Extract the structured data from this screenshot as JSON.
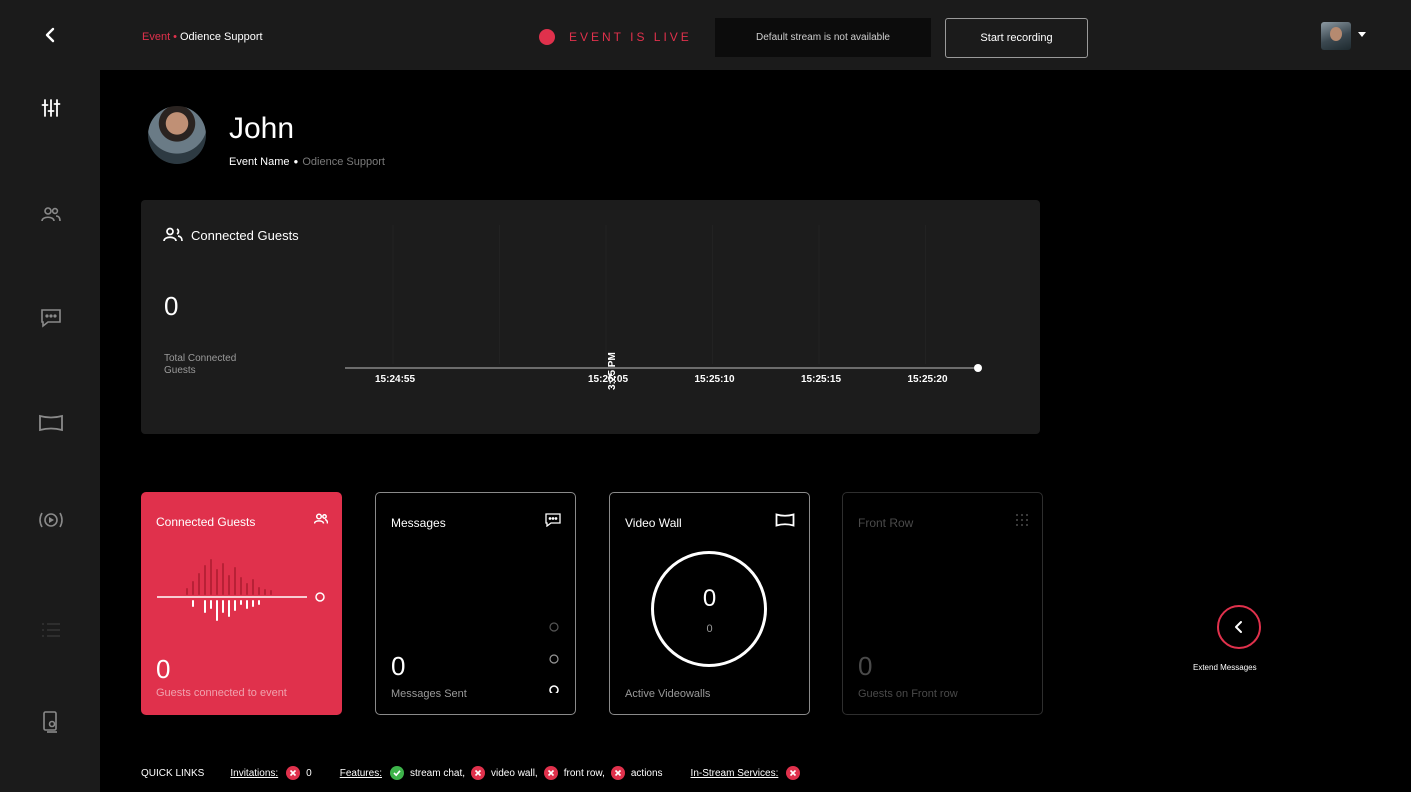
{
  "header": {
    "breadcrumb_event": "Event",
    "breadcrumb_sep": "•",
    "breadcrumb_current": "Odience Support",
    "live_status": "EVENT IS LIVE",
    "stream_status": "Default stream is not available",
    "record_button": "Start recording"
  },
  "sidebar": {
    "items": [
      "controls-icon",
      "guests-icon",
      "messages-icon",
      "videowall-icon",
      "stream-icon",
      "list-icon",
      "device-icon"
    ]
  },
  "profile": {
    "name": "John",
    "event_label": "Event Name",
    "event_value": "Odience Support"
  },
  "guests_panel": {
    "title": "Connected Guests",
    "total": "0",
    "total_label": "Total Connected Guests"
  },
  "chart_data": {
    "type": "line",
    "x": [
      "15:24:55",
      "3:25 PM",
      "15:25:05",
      "15:25:10",
      "15:25:15",
      "15:25:20"
    ],
    "series": [
      {
        "values": [
          0,
          0,
          0,
          0,
          0,
          0
        ]
      }
    ],
    "xlabel": "",
    "ylabel": "",
    "grid": true
  },
  "cards": {
    "guests": {
      "title": "Connected Guests",
      "value": "0",
      "caption": "Guests connected to event"
    },
    "messages": {
      "title": "Messages",
      "value": "0",
      "caption": "Messages Sent"
    },
    "videowall": {
      "title": "Video Wall",
      "value": "0",
      "sub_value": "0",
      "caption": "Active Videowalls"
    },
    "frontrow": {
      "title": "Front Row",
      "value": "0",
      "caption": "Guests on Front row"
    }
  },
  "extend": {
    "label": "Extend Messages"
  },
  "quick_links": {
    "title": "QUICK LINKS",
    "invitations_label": "Invitations:",
    "invitations_count": "0",
    "features_label": "Features:",
    "features": [
      "stream chat,",
      "video wall,",
      "front row,",
      "actions"
    ],
    "services_label": "In-Stream Services:"
  },
  "colors": {
    "accent": "#e0314c",
    "success": "#3db34a",
    "panel": "#1c1c1c",
    "bar": "#1b1b1b"
  }
}
